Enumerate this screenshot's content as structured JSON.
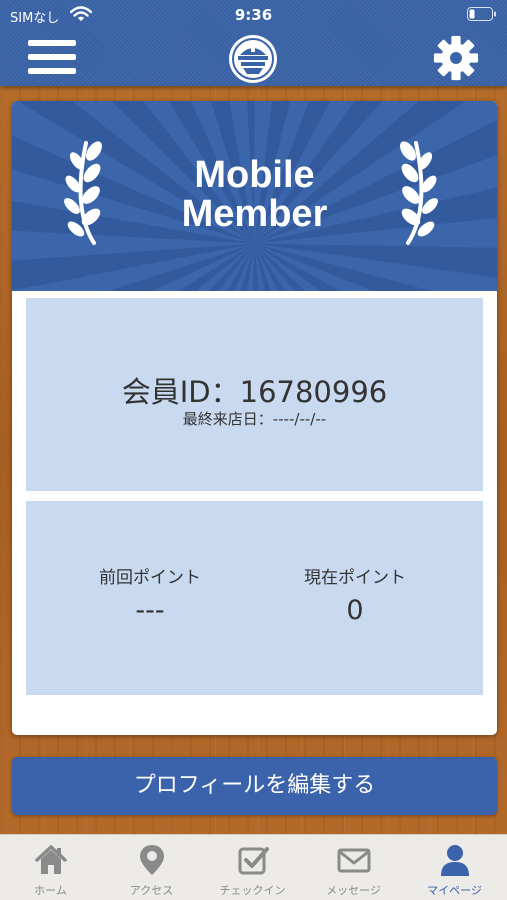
{
  "status_bar": {
    "carrier": "SIMなし",
    "time": "9:36"
  },
  "header": {
    "menu_icon": "hamburger-menu-icon",
    "logo_icon": "shop-logo-icon",
    "settings_icon": "gear-icon"
  },
  "card": {
    "banner_title_line1": "Mobile",
    "banner_title_line2": "Member",
    "member_id": "会員ID：16780996",
    "last_visit": "最終来店日：----/--/--",
    "previous_points_label": "前回ポイント",
    "previous_points_value": "---",
    "current_points_label": "現在ポイント",
    "current_points_value": "0"
  },
  "edit_profile_label": "プロフィールを編集する",
  "tabs": [
    {
      "label": "ホーム",
      "icon": "home-icon"
    },
    {
      "label": "アクセス",
      "icon": "map-pin-icon"
    },
    {
      "label": "チェックイン",
      "icon": "checkbox-icon"
    },
    {
      "label": "メッセージ",
      "icon": "envelope-icon"
    },
    {
      "label": "マイページ",
      "icon": "person-icon",
      "active": true
    }
  ],
  "colors": {
    "header_blue": "#3a64a8",
    "button_blue": "#3b63ab",
    "panel_light_blue": "#c9daf0",
    "tab_active": "#3b63ab",
    "tab_inactive": "#8a8a8a"
  }
}
